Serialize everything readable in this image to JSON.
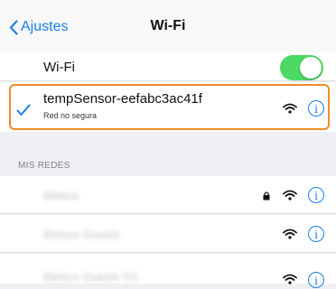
{
  "nav": {
    "back_label": "Ajustes",
    "title": "Wi-Fi"
  },
  "wifi_toggle": {
    "label": "Wi-Fi",
    "on": true
  },
  "connected": {
    "name": "tempSensor-eefabc3ac41f",
    "subtitle": "Red no segura"
  },
  "my_networks": {
    "header": "MIS REDES",
    "items": [
      {
        "name": "Blebox",
        "locked": true
      },
      {
        "name": "Blebox Guests",
        "locked": false
      },
      {
        "name": "Blebox Guests 5G",
        "locked": false
      }
    ]
  },
  "colors": {
    "accent": "#1a7fe5",
    "toggle_on": "#4cd964",
    "highlight": "#ee8a2c"
  }
}
